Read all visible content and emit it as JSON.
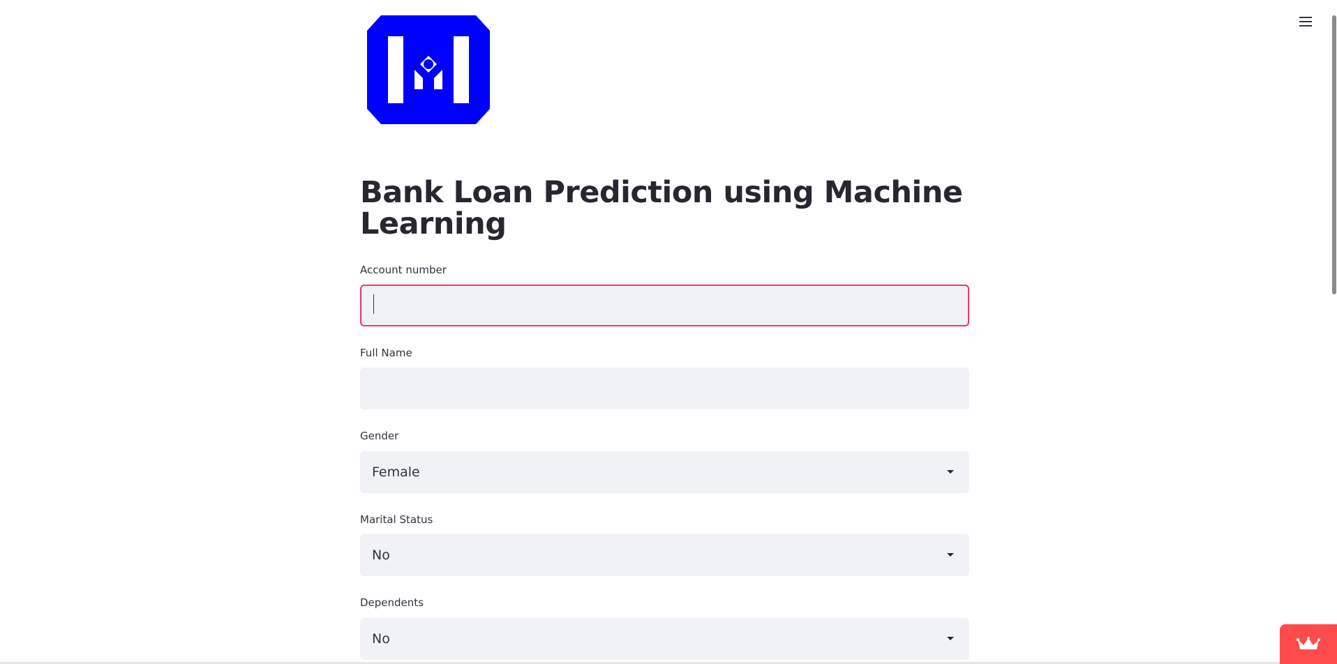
{
  "header": {
    "menu_icon": "hamburger-menu-icon"
  },
  "logo": {
    "icon": "bank-logo-icon",
    "color": "#0000ff"
  },
  "page": {
    "title": "Bank Loan Prediction using Machine Learning"
  },
  "form": {
    "account_number": {
      "label": "Account number",
      "value": ""
    },
    "full_name": {
      "label": "Full Name",
      "value": ""
    },
    "gender": {
      "label": "Gender",
      "selected": "Female"
    },
    "marital_status": {
      "label": "Marital Status",
      "selected": "No"
    },
    "dependents": {
      "label": "Dependents",
      "selected": "No"
    }
  },
  "badge": {
    "icon": "crown-icon",
    "color": "#ff4b4b"
  },
  "colors": {
    "accent": "#f63366",
    "input_bg": "#f0f2f6",
    "text": "#31333f"
  }
}
